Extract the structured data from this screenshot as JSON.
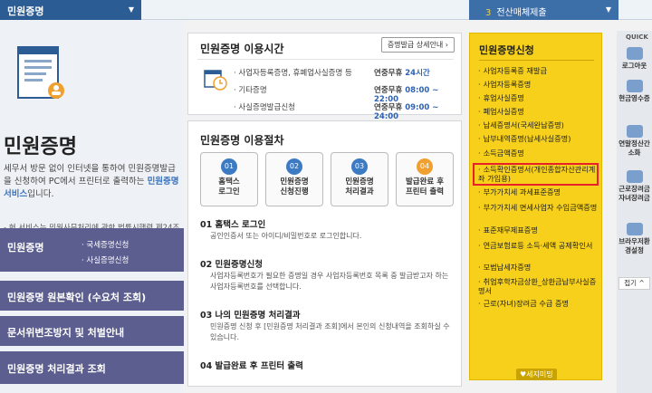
{
  "top": {
    "left_title": "민원증명",
    "right_num": "3",
    "right_title": "전산매체제출"
  },
  "left": {
    "title": "민원증명",
    "desc_pre": "세무서 방문 없이 인터넷을 통하여 민원증명발급을 신청하여 PC에서 프린터로 출력하는 ",
    "desc_hl": "민원증명 서비스",
    "desc_post": "입니다.",
    "note": "- 현 서비스는 민원사무처리에 관한 법률시행령 제24조2의 규정을 따릅니다.",
    "menu": [
      {
        "label": "민원증명",
        "subs": [
          "국세증명신청",
          "사실증명신청"
        ]
      },
      {
        "label": "민원증명 원본확인 (수요처 조회)"
      },
      {
        "label": "문서위변조방지 및 처벌안내"
      },
      {
        "label": "민원증명 처리결과 조회"
      }
    ]
  },
  "hours": {
    "title": "민원증명 이용시간",
    "detail_button": "증명발급 상세안내",
    "rows": [
      {
        "name": "사업자등록증명, 휴폐업사실증명 등",
        "time_label": "연중무휴 ",
        "time": "24시간"
      },
      {
        "name": "기타증명",
        "time_label": "연중무휴 ",
        "time": "08:00 ~ 22:00"
      },
      {
        "name": "사실증명발급신청",
        "time_label": "연중무휴 ",
        "time": "09:00 ~ 24:00"
      }
    ]
  },
  "process": {
    "title": "민원증명 이용절차",
    "steps": [
      {
        "num": "01",
        "line1": "홈택스",
        "line2": "로그인"
      },
      {
        "num": "02",
        "line1": "민원증명",
        "line2": "신청진행"
      },
      {
        "num": "03",
        "line1": "민원증명",
        "line2": "처리결과"
      },
      {
        "num": "04",
        "line1": "발급완료 후",
        "line2": "프린터 출력"
      }
    ],
    "items": [
      {
        "head": "01 홈택스 로그인",
        "desc": "공인인증서 또는 아이디/비밀번호로 로그인합니다."
      },
      {
        "head": "02 민원증명신청",
        "desc": "사업자등록번호가 필요한 증명일 경우 사업자등록번호 목록 중 발급받고자 하는 사업자등록번호를 선택합니다."
      },
      {
        "head": "03 나의 민원증명 처리결과",
        "desc": "민원증명 신청 후 [민원증명 처리결과 조회]에서 본인의 신청내역을 조회하실 수 있습니다."
      },
      {
        "head": "04 발급완료 후 프린터 출력",
        "desc": ""
      }
    ]
  },
  "apply": {
    "title": "민원증명신청",
    "items": [
      "사업자등록증 재발급",
      "사업자등록증명",
      "휴업사실증명",
      "폐업사실증명",
      "납세증명서(국세완납증명)",
      "납부내역증명(납세사실증명)",
      "소득금액증명",
      "소득확인증명서(개인종합자산관리계좌 가입용)",
      "부가가치세 과세표준증명",
      "부가가치세 면세사업자 수입금액증명",
      "표준재무제표증명",
      "연금보험료등 소득·세액 공제확인서",
      "모범납세자증명",
      "취업후학자금상환_상환금납부사실증명서",
      "근로(자녀)장려금 수급 증명"
    ],
    "seal": "세지미밍"
  },
  "quick": {
    "header": "QUICK",
    "items": [
      {
        "label": "로그아웃",
        "icon": "logout-icon"
      },
      {
        "label": "현금영수증",
        "icon": "receipt-icon"
      },
      {
        "label": "연말정산간소화",
        "icon": "calculator-icon"
      },
      {
        "label": "근로장려금자녀장려금",
        "icon": "heart-icon"
      },
      {
        "label": "브라우저환경설정",
        "icon": "gear-icon"
      }
    ],
    "collapse": "접기 ^"
  },
  "colors": {
    "brand": "#2b5c94",
    "menu": "#5c5e8f",
    "panel": "#f6d01b",
    "highlight": "#e8202a"
  }
}
